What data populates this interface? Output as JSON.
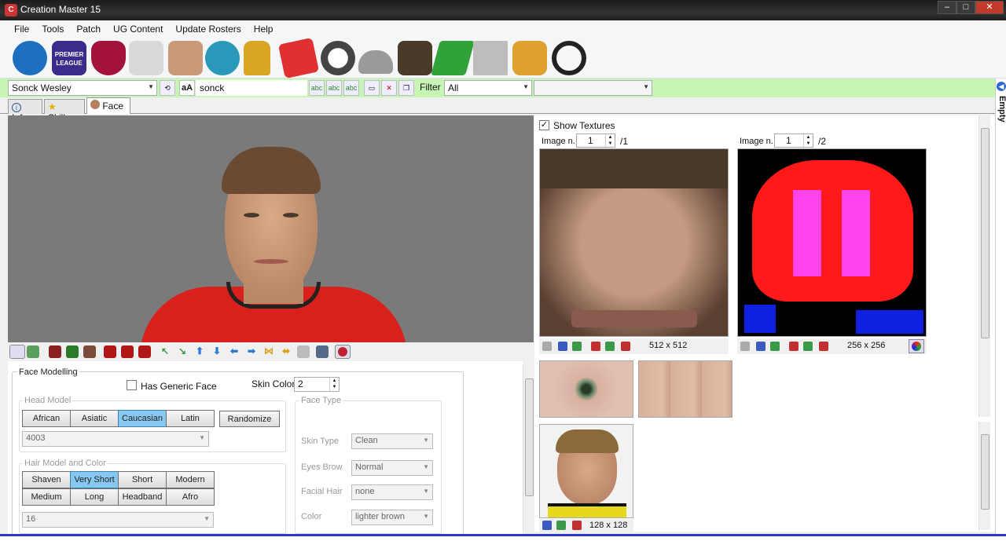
{
  "window": {
    "title": "Creation Master 15",
    "controls": [
      "–",
      "□",
      "✕"
    ]
  },
  "menu": [
    "File",
    "Tools",
    "Patch",
    "UG Content",
    "Update Rosters",
    "Help"
  ],
  "toolbar_icons": [
    {
      "name": "globe-icon",
      "color": "#1f6fc0"
    },
    {
      "name": "premier-league-icon",
      "color": "#3a2b8c",
      "text": "PREMIER LEAGUE"
    },
    {
      "name": "fc-barcelona-icon",
      "color": "#a3123a"
    },
    {
      "name": "jersey-icon",
      "color": "#d9d9d9"
    },
    {
      "name": "player-icon",
      "color": "#c99a78"
    },
    {
      "name": "stadium-icon",
      "color": "#2a98b8"
    },
    {
      "name": "trophy-icon",
      "color": "#d8a620"
    },
    {
      "name": "referee-cards-icon",
      "color": "#e03030"
    },
    {
      "name": "football-icon",
      "color": "#444444"
    },
    {
      "name": "boots-icon",
      "color": "#9a9a9a"
    },
    {
      "name": "manager-icon",
      "color": "#4a3a2a"
    },
    {
      "name": "pitch-icon",
      "color": "#2fa33a"
    },
    {
      "name": "newspaper-icon",
      "color": "#bdbdbd"
    },
    {
      "name": "goalkeeper-gloves-icon",
      "color": "#e0a030"
    },
    {
      "name": "headphones-icon",
      "color": "#222222"
    }
  ],
  "search": {
    "player": "Sonck Wesley",
    "query": "sonck",
    "case_label": "aA",
    "filter_label": "Filter",
    "filter_value": "All",
    "extra_value": ""
  },
  "tabs": [
    {
      "label": "Info",
      "icon": "info-icon"
    },
    {
      "label": "Skills",
      "icon": "star-icon"
    },
    {
      "label": "Face",
      "icon": "face-icon",
      "active": true
    }
  ],
  "face_modelling": {
    "title": "Face Modelling",
    "generic_face_label": "Has Generic Face",
    "generic_face_checked": false,
    "skin_color_label": "Skin Color",
    "skin_color_value": "2",
    "head_model": {
      "label": "Head Model",
      "options": [
        "African",
        "Asiatic",
        "Caucasian",
        "Latin"
      ],
      "selected": "Caucasian",
      "randomize_label": "Randomize",
      "model_id": "4003"
    },
    "hair": {
      "label": "Hair Model and Color",
      "options": [
        "Shaven",
        "Very Short",
        "Short",
        "Modern",
        "Medium",
        "Long",
        "Headband",
        "Afro"
      ],
      "selected": "Very Short",
      "model_id": "16"
    },
    "face_type": {
      "label": "Face Type",
      "fields": [
        {
          "label": "Skin Type",
          "value": "Clean"
        },
        {
          "label": "Eyes Brow",
          "value": "Normal"
        },
        {
          "label": "Facial Hair",
          "value": "none"
        },
        {
          "label": "Color",
          "value": "lighter brown"
        }
      ]
    }
  },
  "textures": {
    "show_label": "Show Textures",
    "show_checked": true,
    "image_label": "Image n.",
    "face": {
      "index": "1",
      "total": "/1",
      "size": "512 x 512"
    },
    "hair": {
      "index": "1",
      "total": "/2",
      "size": "256 x 256"
    },
    "photo": {
      "size": "128 x 128"
    }
  },
  "side_tab_label": "Empty"
}
